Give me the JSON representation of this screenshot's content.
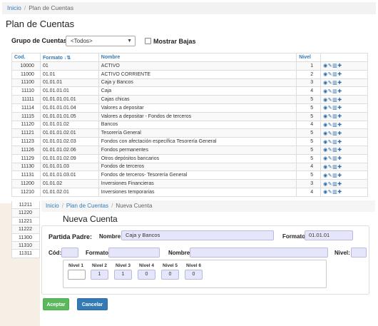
{
  "list_page": {
    "breadcrumb": {
      "home": "Inicio",
      "current": "Plan de Cuentas"
    },
    "title": "Plan de Cuentas",
    "filter_label": "Grupo de Cuentas:",
    "filter_value": "<Todos>",
    "show_inactive_label": "Mostrar Bajas",
    "columns": {
      "cod": "Cod.",
      "formato": "Formato",
      "nombre": "Nombre",
      "nivel": "Nivel"
    },
    "sort_icon": "sort-numeric-icon",
    "row_actions": [
      "view-icon",
      "edit-icon",
      "delete-icon",
      "add-icon"
    ],
    "rows": [
      {
        "cod": "10000",
        "formato": "01",
        "nombre": "ACTIVO",
        "nivel": "1"
      },
      {
        "cod": "11000",
        "formato": "01.01",
        "nombre": "ACTIVO CORRIENTE",
        "nivel": "2"
      },
      {
        "cod": "11100",
        "formato": "01.01.01",
        "nombre": "Caja y Bancos",
        "nivel": "3"
      },
      {
        "cod": "11110",
        "formato": "01.01.01.01",
        "nombre": "Caja",
        "nivel": "4"
      },
      {
        "cod": "11111",
        "formato": "01.01.01.01.01",
        "nombre": "Cajas chicas",
        "nivel": "5"
      },
      {
        "cod": "11114",
        "formato": "01.01.01.01.04",
        "nombre": "Valores a depositar",
        "nivel": "5"
      },
      {
        "cod": "11115",
        "formato": "01.01.01.01.05",
        "nombre": "Valores a depositar - Fondos de terceros",
        "nivel": "5"
      },
      {
        "cod": "11120",
        "formato": "01.01.01.02",
        "nombre": "Bancos",
        "nivel": "4"
      },
      {
        "cod": "11121",
        "formato": "01.01.01.02.01",
        "nombre": "Tesorería General",
        "nivel": "5"
      },
      {
        "cod": "11123",
        "formato": "01.01.01.02.03",
        "nombre": "Fondos con afectación específica Tesorería General",
        "nivel": "5"
      },
      {
        "cod": "11126",
        "formato": "01.01.01.02.06",
        "nombre": "Fondos permanentes",
        "nivel": "5"
      },
      {
        "cod": "11129",
        "formato": "01.01.01.02.09",
        "nombre": "Otros depósitos bancarios",
        "nivel": "5"
      },
      {
        "cod": "11130",
        "formato": "01.01.01.03",
        "nombre": "Fondos de terceros",
        "nivel": "4"
      },
      {
        "cod": "11131",
        "formato": "01.01.01.03.01",
        "nombre": "Fondos de terceros- Tesorería General",
        "nivel": "5"
      },
      {
        "cod": "11200",
        "formato": "01.01.02",
        "nombre": "Inversiones Financieras",
        "nivel": "3"
      },
      {
        "cod": "11210",
        "formato": "01.01.02.01",
        "nombre": "Inversiones temporarias",
        "nivel": "4"
      }
    ],
    "hidden_cods": [
      "11211",
      "11220",
      "11221",
      "11222",
      "11300",
      "11310",
      "11311"
    ]
  },
  "form_page": {
    "breadcrumb": {
      "home": "Inicio",
      "parent": "Plan de Cuentas",
      "current": "Nueva Cuenta"
    },
    "title": "Nueva Cuenta",
    "parent_label": "Partida Padre:",
    "nombre_label": "Nombre:",
    "parent_nombre": "Caja y Bancos",
    "formato_label": "Formato:",
    "parent_formato": "01.01.01",
    "cod_label": "Cód:",
    "cod_value": "",
    "new_formato_label": "Formato:",
    "new_formato_value": "",
    "new_nombre_label": "Nombre:",
    "new_nombre_value": "",
    "nivel_label": "Nivel:",
    "nivel_value": "",
    "levels": [
      {
        "label": "Nivel 1",
        "value": ""
      },
      {
        "label": "Nivel 2",
        "value": "1"
      },
      {
        "label": "Nivel 3",
        "value": "1"
      },
      {
        "label": "Nivel 4",
        "value": "0"
      },
      {
        "label": "Nivel 5",
        "value": "0"
      },
      {
        "label": "Nivel 6",
        "value": "0"
      }
    ],
    "accept_label": "Aceptar",
    "cancel_label": "Cancelar"
  },
  "colors": {
    "link": "#337ab7",
    "accept": "#5cb85c",
    "cancel": "#337ab7",
    "input_bg": "#e6e6fa"
  }
}
